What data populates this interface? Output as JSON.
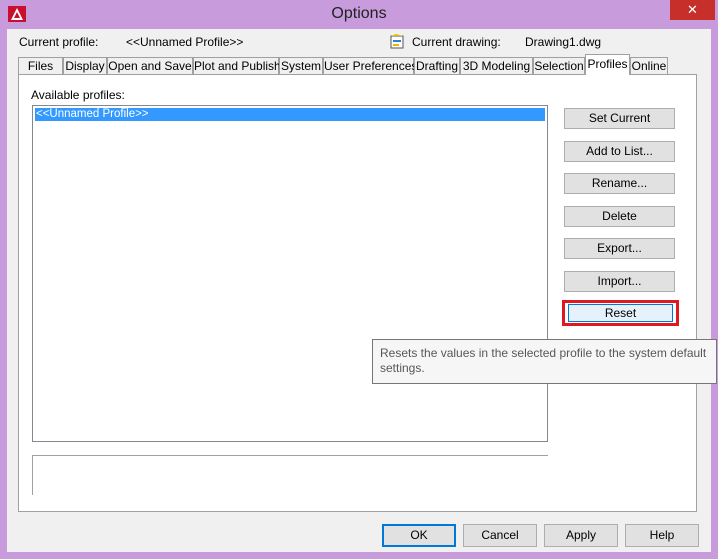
{
  "window": {
    "title": "Options",
    "close_glyph": "✕"
  },
  "header": {
    "current_profile_label": "Current profile:",
    "current_profile_value": "<<Unnamed Profile>>",
    "current_drawing_label": "Current drawing:",
    "current_drawing_value": "Drawing1.dwg"
  },
  "tabs": [
    {
      "label": "Files"
    },
    {
      "label": "Display"
    },
    {
      "label": "Open and Save"
    },
    {
      "label": "Plot and Publish"
    },
    {
      "label": "System"
    },
    {
      "label": "User Preferences"
    },
    {
      "label": "Drafting"
    },
    {
      "label": "3D Modeling"
    },
    {
      "label": "Selection"
    },
    {
      "label": "Profiles",
      "active": true
    },
    {
      "label": "Online"
    }
  ],
  "profiles": {
    "available_label": "Available profiles:",
    "items": [
      "<<Unnamed Profile>>"
    ],
    "selected_index": 0,
    "description": ""
  },
  "side_buttons": {
    "set_current": "Set Current",
    "add_to_list": "Add to List...",
    "rename": "Rename...",
    "delete": "Delete",
    "export": "Export...",
    "import": "Import...",
    "reset": "Reset"
  },
  "tooltip": {
    "text": "Resets the values in the selected profile to the system default settings."
  },
  "bottom_buttons": {
    "ok": "OK",
    "cancel": "Cancel",
    "apply": "Apply",
    "help": "Help"
  },
  "colors": {
    "title_bar": "#c79bdc",
    "close": "#c7302a",
    "selection": "#3399ff",
    "highlight": "#e0181f"
  }
}
